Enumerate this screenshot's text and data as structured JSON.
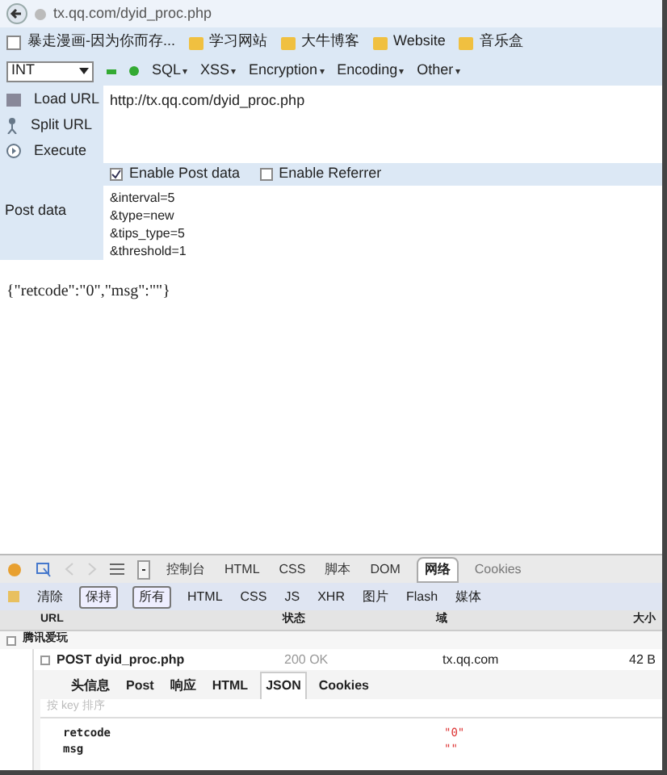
{
  "address_bar": {
    "url": "tx.qq.com/dyid_proc.php"
  },
  "bookmarks": [
    {
      "label": "暴走漫画-因为你而存...",
      "kind": "page"
    },
    {
      "label": "学习网站",
      "kind": "folder"
    },
    {
      "label": "大牛博客",
      "kind": "folder"
    },
    {
      "label": "Website",
      "kind": "folder"
    },
    {
      "label": "音乐盒",
      "kind": "folder"
    }
  ],
  "hackbar": {
    "select": "INT",
    "menus": [
      "SQL",
      "XSS",
      "Encryption",
      "Encoding",
      "Other"
    ],
    "actions": [
      {
        "label": "Load URL",
        "kind": "load"
      },
      {
        "label": "Split URL",
        "kind": "split"
      },
      {
        "label": "Execute",
        "kind": "execute"
      }
    ],
    "url": "http://tx.qq.com/dyid_proc.php",
    "options": [
      {
        "label": "Enable Post data",
        "checked": true
      },
      {
        "label": "Enable Referrer",
        "checked": false
      }
    ],
    "post_label": "Post data",
    "post_lines": [
      "&interval=5",
      "&type=new",
      "&tips_type=5",
      "&threshold=1"
    ]
  },
  "page_content": "{\"retcode\":\"0\",\"msg\":\"\"}",
  "firebug": {
    "tabs": [
      {
        "label": "控制台",
        "selected": false
      },
      {
        "label": "HTML",
        "selected": false
      },
      {
        "label": "CSS",
        "selected": false
      },
      {
        "label": "脚本",
        "selected": false
      },
      {
        "label": "DOM",
        "selected": false
      },
      {
        "label": "网络",
        "selected": true
      },
      {
        "label": "Cookies",
        "selected": false
      }
    ],
    "filters": [
      {
        "label": "清除",
        "selected": false
      },
      {
        "label": "保持",
        "selected": true
      },
      {
        "label": "所有",
        "selected": true
      },
      {
        "label": "HTML",
        "selected": false
      },
      {
        "label": "CSS",
        "selected": false
      },
      {
        "label": "JS",
        "selected": false
      },
      {
        "label": "XHR",
        "selected": false
      },
      {
        "label": "图片",
        "selected": false
      },
      {
        "label": "Flash",
        "selected": false
      },
      {
        "label": "媒体",
        "selected": false
      }
    ],
    "columns": [
      "URL",
      "状态",
      "域",
      "大小"
    ],
    "group": {
      "label": "腾讯爱玩",
      "expanded": true
    },
    "request": {
      "url": "POST dyid_proc.php",
      "status": "200 OK",
      "domain": "tx.qq.com",
      "size": "42 B",
      "expanded": true
    },
    "detail_tabs": [
      {
        "label": "头信息",
        "selected": false
      },
      {
        "label": "Post",
        "selected": false
      },
      {
        "label": "响应",
        "selected": false
      },
      {
        "label": "HTML",
        "selected": false
      },
      {
        "label": "JSON",
        "selected": true
      },
      {
        "label": "Cookies",
        "selected": false
      }
    ],
    "sort_label": "按 key 排序",
    "json_rows": [
      {
        "key": "retcode",
        "value": "\"0\""
      },
      {
        "key": "msg",
        "value": "\"\""
      }
    ]
  }
}
